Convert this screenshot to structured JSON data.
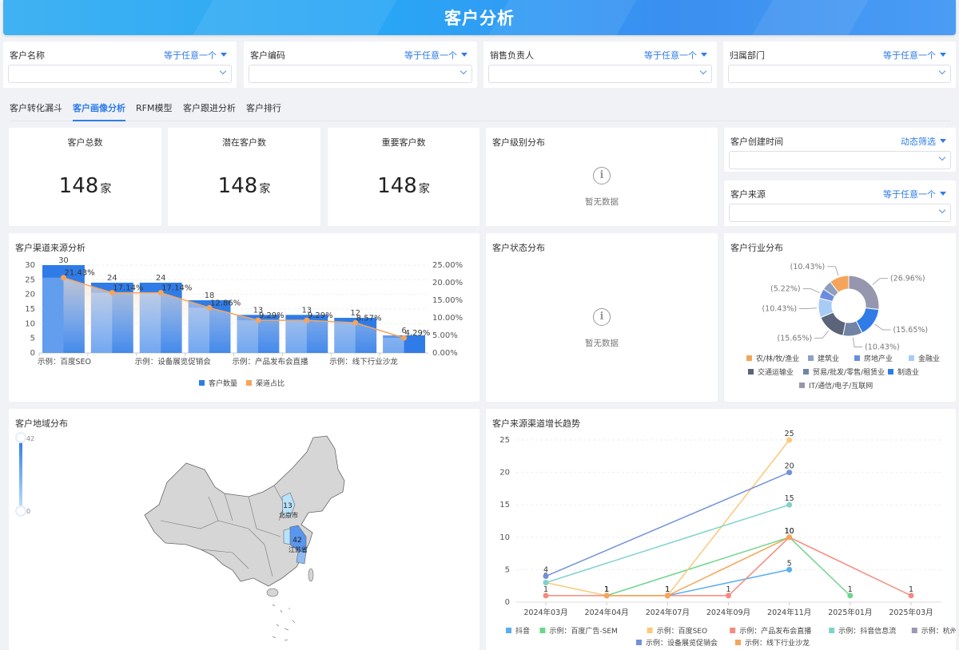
{
  "header": {
    "title": "客户分析"
  },
  "filters": [
    {
      "label": "客户名称",
      "operator": "等于任意一个",
      "value": ""
    },
    {
      "label": "客户编码",
      "operator": "等于任意一个",
      "value": ""
    },
    {
      "label": "销售负责人",
      "operator": "等于任意一个",
      "value": ""
    },
    {
      "label": "归属部门",
      "operator": "等于任意一个",
      "value": ""
    }
  ],
  "tabs": [
    {
      "label": "客户转化漏斗",
      "active": false
    },
    {
      "label": "客户画像分析",
      "active": true
    },
    {
      "label": "RFM模型",
      "active": false
    },
    {
      "label": "客户跟进分析",
      "active": false
    },
    {
      "label": "客户排行",
      "active": false
    }
  ],
  "kpis": [
    {
      "title": "客户总数",
      "value": "148",
      "unit": "家"
    },
    {
      "title": "潜在客户数",
      "value": "148",
      "unit": "家"
    },
    {
      "title": "重要客户数",
      "value": "148",
      "unit": "家"
    }
  ],
  "level_dist": {
    "title": "客户级别分布",
    "empty_text": "暂无数据"
  },
  "status_dist": {
    "title": "客户状态分布",
    "empty_text": "暂无数据"
  },
  "side_filters": [
    {
      "label": "客户创建时间",
      "operator": "动态筛选",
      "value": ""
    },
    {
      "label": "客户来源",
      "operator": "等于任意一个",
      "value": ""
    }
  ],
  "chart_data": [
    {
      "type": "bar",
      "title": "客户渠道来源分析",
      "categories": [
        "示例：百度SEO",
        "",
        "示例：设备展览促销会",
        "",
        "示例：产品发布会直播",
        "",
        "示例：线下行业沙龙",
        ""
      ],
      "series": [
        {
          "name": "客户数量",
          "type": "bar",
          "axis": "left",
          "color": "#2f7ce8",
          "values": [
            30,
            24,
            24,
            18,
            13,
            13,
            12,
            6
          ]
        },
        {
          "name": "渠道占比",
          "type": "line",
          "axis": "right",
          "color": "#f5a55b",
          "values": [
            21.43,
            17.14,
            17.14,
            12.86,
            9.29,
            9.29,
            8.57,
            4.29
          ],
          "labels": [
            "21.43%",
            "17.14%",
            "17.14%",
            "12.86%",
            "9.29%",
            "9.29%",
            "8.57%",
            "4.29%"
          ]
        }
      ],
      "y_left": {
        "ticks": [
          "0",
          "5",
          "10",
          "15",
          "20",
          "25",
          "30"
        ],
        "range": [
          0,
          30
        ]
      },
      "y_right": {
        "ticks": [
          "0.00%",
          "5.00%",
          "10.00%",
          "15.00%",
          "20.00%",
          "25.00%"
        ],
        "range": [
          0,
          25
        ]
      },
      "legend": "bottom"
    },
    {
      "type": "pie",
      "title": "客户行业分布",
      "slices": [
        {
          "name": "IT/通信/电子/互联网",
          "value": 26.96,
          "label": "(26.96%)",
          "color": "#9696ae"
        },
        {
          "name": "制造业",
          "value": 15.65,
          "label": "(15.65%)",
          "color": "#2f7ce8"
        },
        {
          "name": "贸易/批发/零售/租赁业",
          "value": 10.43,
          "label": "(10.43%)",
          "color": "#7283a6"
        },
        {
          "name": "交通运输业",
          "value": 15.65,
          "label": "(15.65%)",
          "color": "#5b6478"
        },
        {
          "name": "金融业",
          "value": 10.43,
          "label": "(10.43%)",
          "color": "#a8cbf5"
        },
        {
          "name": "房地产业",
          "value": 5.22,
          "label": "(5.22%)",
          "color": "#6c8cde"
        },
        {
          "name": "建筑业",
          "value": 5.22,
          "label": "",
          "color": "#8f9fc0"
        },
        {
          "name": "农/林/牧/渔业",
          "value": 10.43,
          "label": "(10.43%)",
          "color": "#f5a55b"
        }
      ],
      "legend_order": [
        "农/林/牧/渔业",
        "建筑业",
        "房地产业",
        "金融业",
        "交通运输业",
        "贸易/批发/零售/租赁业",
        "制造业",
        "IT/通信/电子/互联网"
      ],
      "legend": "bottom"
    },
    {
      "type": "line",
      "title": "客户来源渠道增长趋势",
      "categories": [
        "2024年03月",
        "2024年04月",
        "2024年07月",
        "2024年09月",
        "2024年11月",
        "2025年01月",
        "2025年03月"
      ],
      "y": {
        "ticks": [
          "0",
          "5",
          "10",
          "15",
          "20",
          "25"
        ],
        "range": [
          0,
          25
        ]
      },
      "series": [
        {
          "name": "抖音",
          "color": "#5aaef0",
          "values": [
            null,
            null,
            1,
            null,
            5,
            null,
            null
          ]
        },
        {
          "name": "示例：百度广告-SEM",
          "color": "#6dd58c",
          "values": [
            null,
            1,
            null,
            null,
            10,
            1,
            null
          ]
        },
        {
          "name": "示例：百度SEO",
          "color": "#fac97a",
          "values": [
            3,
            1,
            1,
            null,
            25,
            null,
            null
          ]
        },
        {
          "name": "示例：产品发布会直播",
          "color": "#f58a7e",
          "values": [
            1,
            1,
            1,
            1,
            10,
            null,
            1
          ]
        },
        {
          "name": "示例：抖音信息流",
          "color": "#7ed3cc",
          "values": [
            3,
            null,
            null,
            null,
            15,
            null,
            null
          ]
        },
        {
          "name": "示例：杭州渠道商合作",
          "color": "#9a98b2",
          "values": [
            null,
            null,
            null,
            null,
            null,
            null,
            null
          ]
        },
        {
          "name": "示例：设备展览促销会",
          "color": "#7390dc",
          "values": [
            4,
            null,
            null,
            null,
            20,
            null,
            null
          ]
        },
        {
          "name": "示例：线下行业沙龙",
          "color": "#f5a55b",
          "values": [
            null,
            1,
            1,
            null,
            10,
            null,
            null
          ]
        }
      ],
      "legend": "bottom"
    }
  ],
  "geo": {
    "title": "客户地域分布",
    "scale_max": "42",
    "scale_min": "0",
    "regions": [
      {
        "name": "北京市",
        "value": "13"
      },
      {
        "name": "江苏省",
        "value": "42"
      }
    ]
  }
}
